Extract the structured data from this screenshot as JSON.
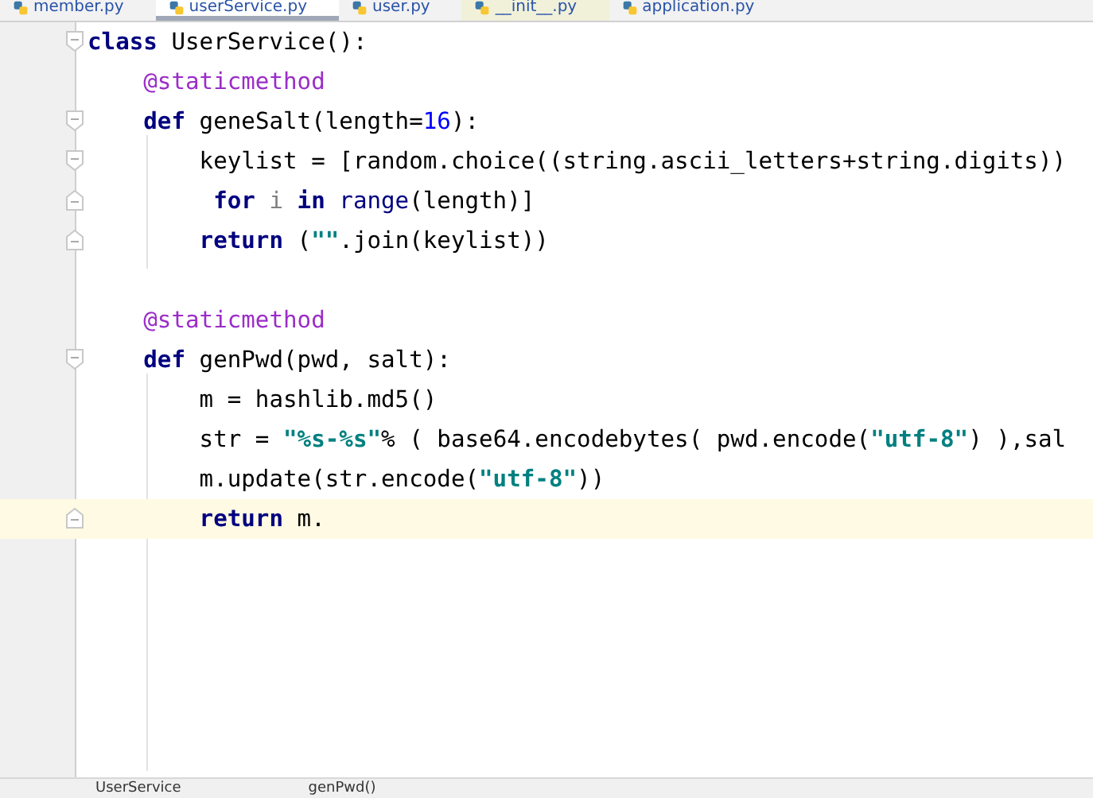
{
  "tabs": [
    {
      "label": "member.py",
      "selected": false
    },
    {
      "label": "userService.py",
      "selected": true
    },
    {
      "label": "user.py",
      "selected": false
    },
    {
      "label": "__init__.py",
      "selected": false
    },
    {
      "label": "application.py",
      "selected": false
    }
  ],
  "code_lines": [
    {
      "fold_open": true,
      "fold_close": false,
      "current": false,
      "tokens": [
        {
          "kind": "kw",
          "text": "class"
        },
        {
          "kind": "plain",
          "text": " UserService():"
        }
      ]
    },
    {
      "fold_open": false,
      "fold_close": false,
      "current": false,
      "tokens": [
        {
          "kind": "deco",
          "text": "    @staticmethod"
        }
      ]
    },
    {
      "fold_open": true,
      "fold_close": false,
      "current": false,
      "tokens": [
        {
          "kind": "kw",
          "text": "    def"
        },
        {
          "kind": "plain",
          "text": " geneSalt(length="
        },
        {
          "kind": "num",
          "text": "16"
        },
        {
          "kind": "plain",
          "text": "):"
        }
      ]
    },
    {
      "fold_open": true,
      "fold_close": false,
      "current": false,
      "tokens": [
        {
          "kind": "plain",
          "text": "        keylist = [random.choice((string.ascii_letters+string.digits))"
        }
      ]
    },
    {
      "fold_open": false,
      "fold_close": true,
      "current": false,
      "tokens": [
        {
          "kind": "kw",
          "text": "         for"
        },
        {
          "kind": "var",
          "text": " i"
        },
        {
          "kind": "kw",
          "text": " in"
        },
        {
          "kind": "builtin",
          "text": " range"
        },
        {
          "kind": "plain",
          "text": "(length)]"
        }
      ]
    },
    {
      "fold_open": false,
      "fold_close": true,
      "current": false,
      "tokens": [
        {
          "kind": "kw",
          "text": "        return"
        },
        {
          "kind": "plain",
          "text": " ("
        },
        {
          "kind": "str",
          "text": "\"\""
        },
        {
          "kind": "plain",
          "text": ".join(keylist))"
        }
      ]
    },
    {
      "fold_open": false,
      "fold_close": false,
      "current": false
    },
    {
      "fold_open": false,
      "fold_close": false,
      "current": false,
      "tokens": [
        {
          "kind": "deco",
          "text": "    @staticmethod"
        }
      ]
    },
    {
      "fold_open": true,
      "fold_close": false,
      "current": false,
      "tokens": [
        {
          "kind": "kw",
          "text": "    def"
        },
        {
          "kind": "plain",
          "text": " genPwd(pwd, salt):"
        }
      ]
    },
    {
      "fold_open": false,
      "fold_close": false,
      "current": false,
      "tokens": [
        {
          "kind": "plain",
          "text": "        m = hashlib.md5()"
        }
      ]
    },
    {
      "fold_open": false,
      "fold_close": false,
      "current": false,
      "tokens": [
        {
          "kind": "plain",
          "text": "        str = "
        },
        {
          "kind": "str",
          "text": "\"%s-%s\""
        },
        {
          "kind": "plain",
          "text": "% ( base64.encodebytes( pwd.encode("
        },
        {
          "kind": "str",
          "text": "\"utf-8\""
        },
        {
          "kind": "plain",
          "text": ") ),sal"
        }
      ]
    },
    {
      "fold_open": false,
      "fold_close": false,
      "current": false,
      "tokens": [
        {
          "kind": "plain",
          "text": "        m.update(str.encode("
        },
        {
          "kind": "str",
          "text": "\"utf-8\""
        },
        {
          "kind": "plain",
          "text": "))"
        }
      ]
    },
    {
      "fold_open": false,
      "fold_close": true,
      "current": true,
      "tokens": [
        {
          "kind": "kw",
          "text": "        return"
        },
        {
          "kind": "plain",
          "text": " m."
        }
      ]
    }
  ],
  "breadcrumbs": [
    "UserService",
    "genPwd()"
  ]
}
